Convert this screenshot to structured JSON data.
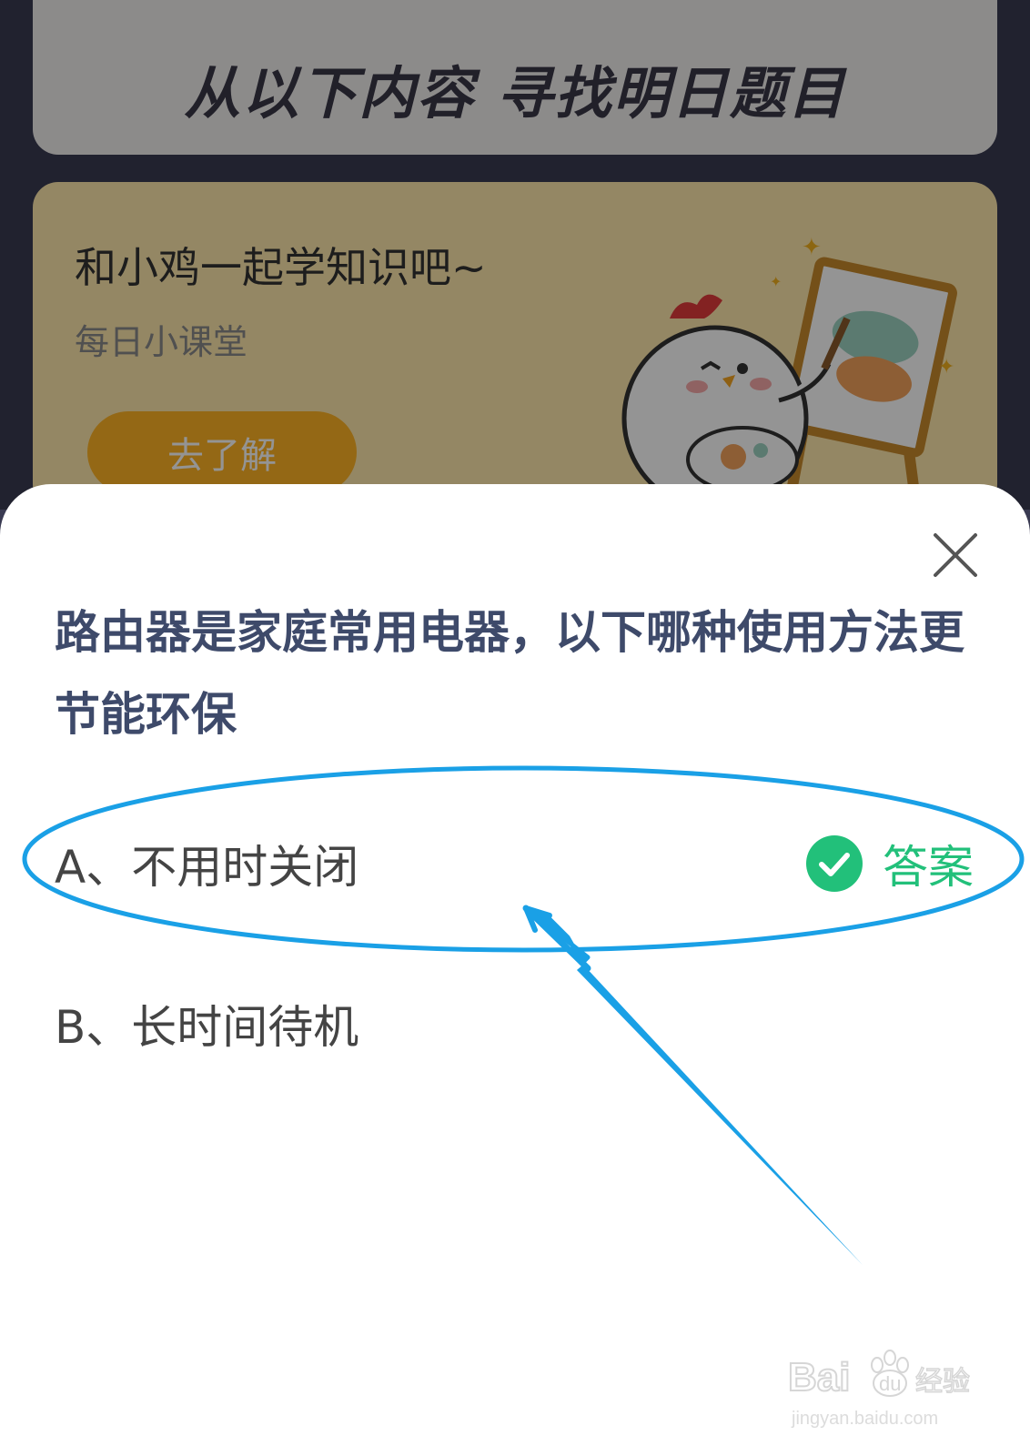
{
  "background": {
    "title": "从以下内容 寻找明日题目",
    "promo": {
      "heading": "和小鸡一起学知识吧~",
      "subtitle": "每日小课堂",
      "button_label": "去了解"
    }
  },
  "sheet": {
    "question": "路由器是家庭常用电器，以下哪种使用方法更节能环保",
    "options": [
      {
        "label": "A、不用时关闭",
        "is_answer": true,
        "answer_label": "答案"
      },
      {
        "label": "B、长时间待机",
        "is_answer": false
      }
    ]
  },
  "watermark": {
    "logo_text": "Bai du 经验",
    "url": "jingyan.baidu.com"
  },
  "colors": {
    "answer_green": "#22c07a",
    "annotation_blue": "#1aa0e6",
    "question_text": "#3e4a6a"
  },
  "icons": [
    "close-icon",
    "check-icon",
    "mascot-chicken-illustration"
  ]
}
